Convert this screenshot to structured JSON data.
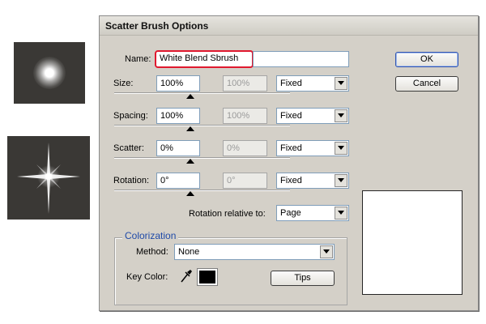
{
  "dialog": {
    "title": "Scatter Brush Options",
    "name_label": "Name:",
    "name_value": "White Blend Sbrush",
    "ok_label": "OK",
    "cancel_label": "Cancel",
    "rows": [
      {
        "label": "Size:",
        "value": "100%",
        "disabled_value": "100%",
        "mode": "Fixed",
        "slider_level": 0.5
      },
      {
        "label": "Spacing:",
        "value": "100%",
        "disabled_value": "100%",
        "mode": "Fixed",
        "slider_level": 0.5
      },
      {
        "label": "Scatter:",
        "value": "0%",
        "disabled_value": "0%",
        "mode": "Fixed",
        "slider_level": 0.5
      },
      {
        "label": "Rotation:",
        "value": "0°",
        "disabled_value": "0°",
        "mode": "Fixed",
        "slider_level": 0.5
      }
    ],
    "rotation_relative_label": "Rotation relative to:",
    "rotation_relative_value": "Page",
    "colorization": {
      "title": "Colorization",
      "method_label": "Method:",
      "method_value": "None",
      "key_color_label": "Key Color:",
      "key_color": "#000000",
      "tips_label": "Tips"
    }
  },
  "colors": {
    "dialog_bg": "#d4d0c8",
    "highlight_outline": "#e0192f",
    "group_title": "#1f4aa8"
  },
  "icons": {
    "eyedropper": "eyedropper-icon",
    "dropdown": "chevron-down-icon"
  }
}
